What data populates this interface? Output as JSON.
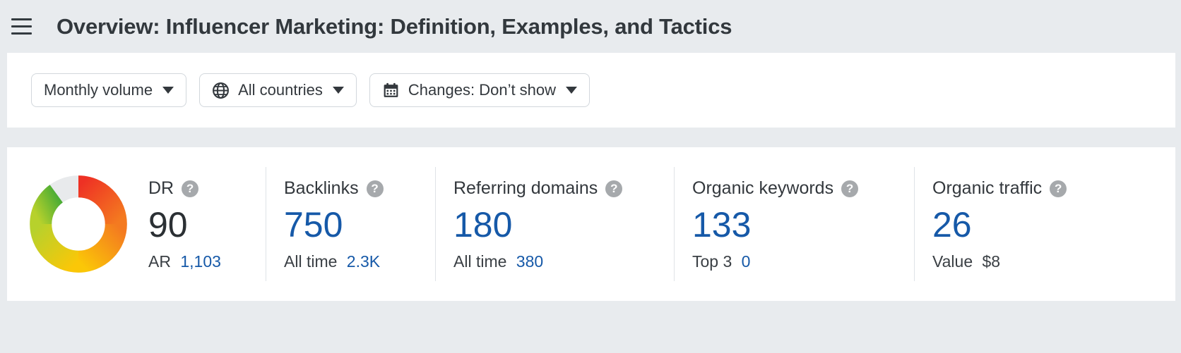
{
  "header": {
    "menu_icon": "hamburger-menu-icon",
    "title": "Overview: Influencer Marketing: Definition, Examples, and Tactics"
  },
  "filters": [
    {
      "id": "mode",
      "label": "Monthly volume",
      "icon": "",
      "caret": "chevron-down-icon"
    },
    {
      "id": "country",
      "label": "All countries",
      "icon": "globe-icon",
      "caret": "chevron-down-icon"
    },
    {
      "id": "changes",
      "label": "Changes: Don’t show",
      "icon": "calendar-icon",
      "caret": "chevron-down-icon"
    }
  ],
  "donut": {
    "name": "dr-donut-chart",
    "filled_percent": 90,
    "gap_percent": 10,
    "track_color": "#e8eaec",
    "colors": [
      "#ee3124",
      "#f47a20",
      "#f9b221",
      "#fcd307",
      "#c3d42a",
      "#5eb031"
    ]
  },
  "metrics": [
    {
      "id": "dr",
      "title": "DR",
      "help": "?",
      "value": "90",
      "value_color": "dark",
      "sub_label": "AR",
      "sub_value": "1,103",
      "sub_value_color": "blue"
    },
    {
      "id": "backlinks",
      "title": "Backlinks",
      "help": "?",
      "value": "750",
      "value_color": "blue",
      "sub_label": "All time",
      "sub_value": "2.3K",
      "sub_value_color": "blue"
    },
    {
      "id": "referring-domains",
      "title": "Referring domains",
      "help": "?",
      "value": "180",
      "value_color": "blue",
      "sub_label": "All time",
      "sub_value": "380",
      "sub_value_color": "blue"
    },
    {
      "id": "organic-keywords",
      "title": "Organic keywords",
      "help": "?",
      "value": "133",
      "value_color": "blue",
      "sub_label": "Top 3",
      "sub_value": "0",
      "sub_value_color": "blue"
    },
    {
      "id": "organic-traffic",
      "title": "Organic traffic",
      "help": "?",
      "value": "26",
      "value_color": "blue",
      "sub_label": "Value",
      "sub_value": "$8",
      "sub_value_color": "dark"
    }
  ],
  "colors": {
    "page_background": "#e8ebee",
    "card_background": "#ffffff",
    "accent_blue": "#1659a8",
    "text_dark": "#33383d",
    "divider": "#dfe3e7"
  }
}
